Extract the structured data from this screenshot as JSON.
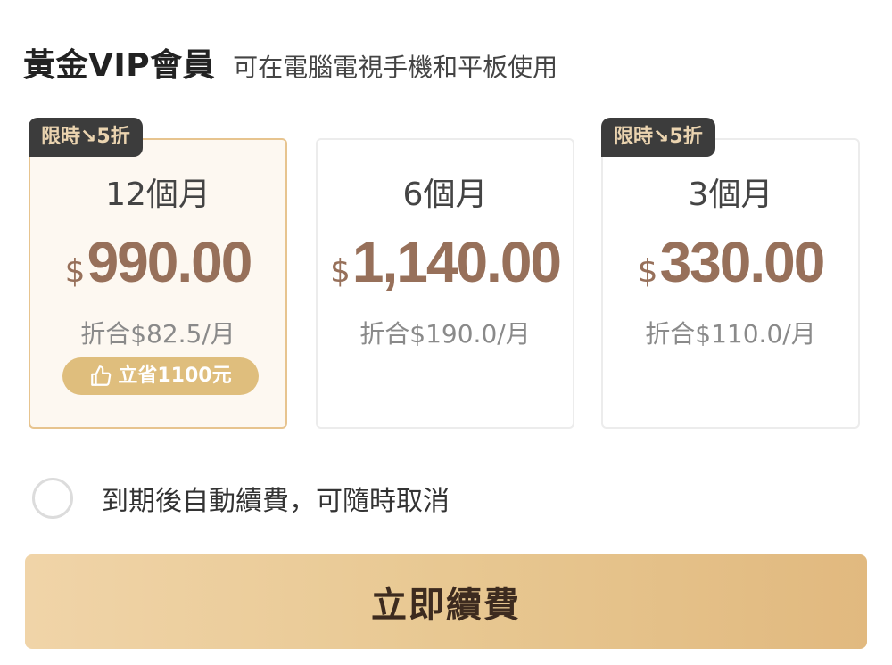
{
  "header": {
    "title": "黃金VIP會員",
    "subtitle": "可在電腦電視手機和平板使用"
  },
  "plans": [
    {
      "badge": "限時↘5折",
      "period": "12個月",
      "currency": "$",
      "price": "990.00",
      "per_month": "折合$82.5/月",
      "savings": "立省1100元",
      "selected": true
    },
    {
      "period": "6個月",
      "currency": "$",
      "price": "1,140.00",
      "per_month": "折合$190.0/月",
      "selected": false
    },
    {
      "badge": "限時↘5折",
      "period": "3個月",
      "currency": "$",
      "price": "330.00",
      "per_month": "折合$110.0/月",
      "selected": false
    }
  ],
  "auto_renew": {
    "label": "到期後自動續費，可隨時取消",
    "checked": false
  },
  "cta": {
    "label": "立即續費"
  },
  "icons": {
    "savings_icon": "thumbs-up-icon"
  },
  "colors": {
    "price": "#97705a",
    "badge_bg": "#3c3c3c",
    "badge_text": "#ebd4b0",
    "selected_border": "#e7c48f",
    "selected_bg": "#fdf8f1",
    "savings_pill": "#dfbe7d",
    "cta_start": "#f0d4a8",
    "cta_end": "#e1b97f"
  }
}
